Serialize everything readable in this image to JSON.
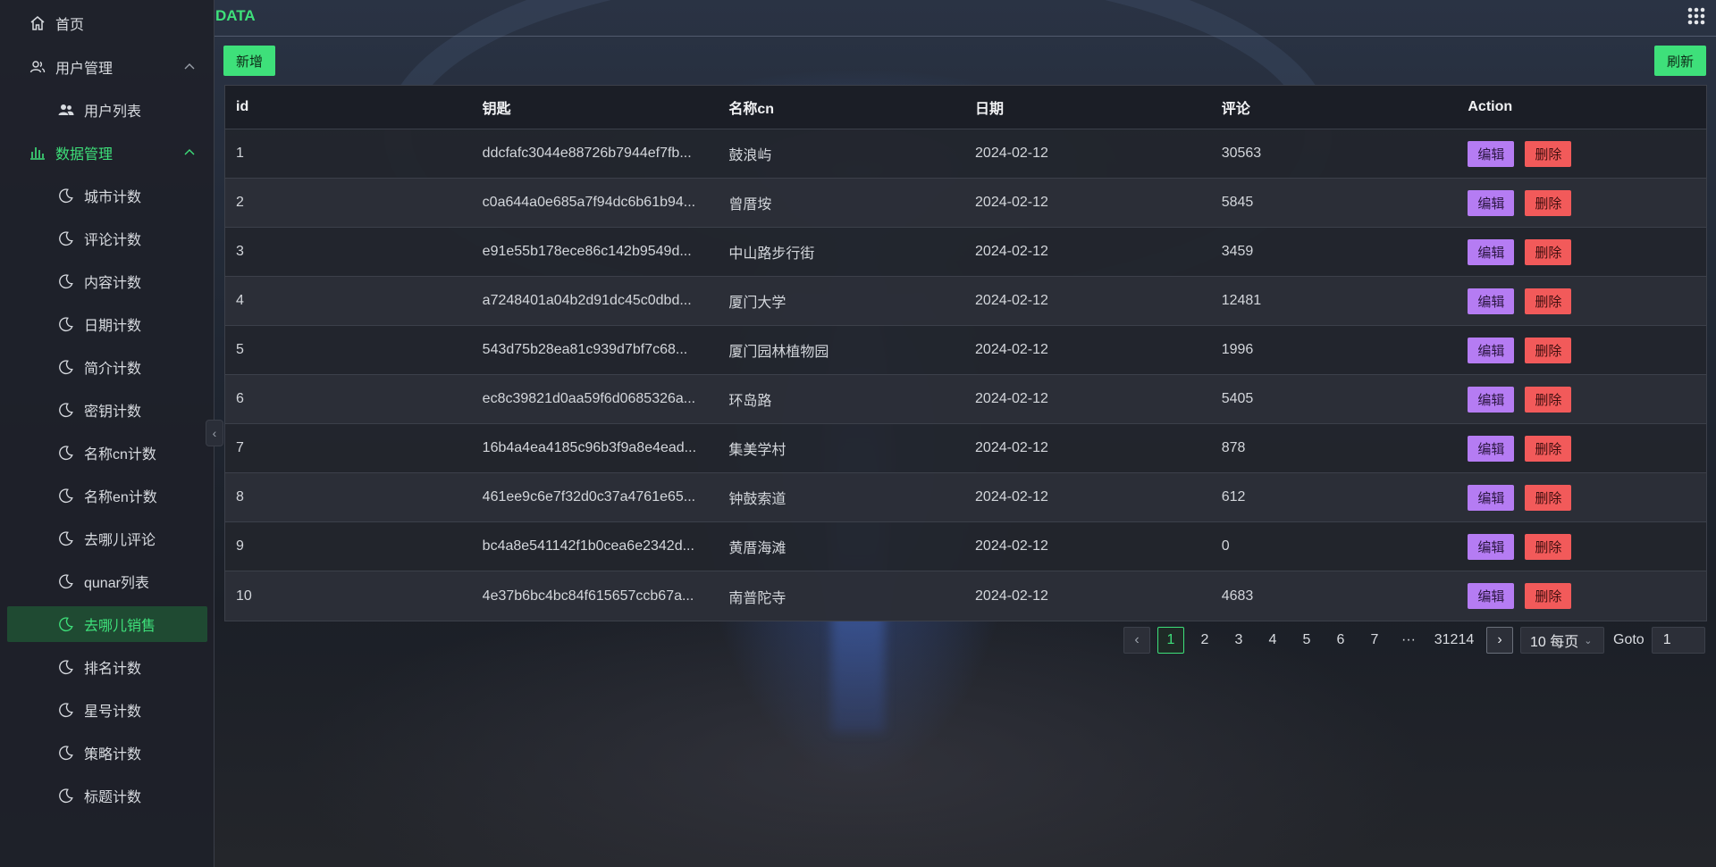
{
  "app": {
    "title": "DATA"
  },
  "sidebar": {
    "items": [
      {
        "label": "首页",
        "icon": "home-icon"
      },
      {
        "label": "用户管理",
        "icon": "users-icon"
      },
      {
        "label": "用户列表",
        "icon": "user-group-icon"
      },
      {
        "label": "数据管理",
        "icon": "bar-chart-icon"
      },
      {
        "label": "城市计数",
        "icon": "moon-icon"
      },
      {
        "label": "评论计数",
        "icon": "moon-icon"
      },
      {
        "label": "内容计数",
        "icon": "moon-icon"
      },
      {
        "label": "日期计数",
        "icon": "moon-icon"
      },
      {
        "label": "简介计数",
        "icon": "moon-icon"
      },
      {
        "label": "密钥计数",
        "icon": "moon-icon"
      },
      {
        "label": "名称cn计数",
        "icon": "moon-icon"
      },
      {
        "label": "名称en计数",
        "icon": "moon-icon"
      },
      {
        "label": "去哪儿评论",
        "icon": "moon-icon"
      },
      {
        "label": "qunar列表",
        "icon": "moon-icon"
      },
      {
        "label": "去哪儿销售",
        "icon": "moon-icon"
      },
      {
        "label": "排名计数",
        "icon": "moon-icon"
      },
      {
        "label": "星号计数",
        "icon": "moon-icon"
      },
      {
        "label": "策略计数",
        "icon": "moon-icon"
      },
      {
        "label": "标题计数",
        "icon": "moon-icon"
      }
    ],
    "active_item": "去哪儿销售"
  },
  "toolbar": {
    "add_label": "新增",
    "refresh_label": "刷新"
  },
  "table": {
    "columns": [
      "id",
      "钥匙",
      "名称cn",
      "日期",
      "评论",
      "Action"
    ],
    "edit_label": "编辑",
    "delete_label": "删除",
    "rows": [
      {
        "id": "1",
        "key": "ddcfafc3044e88726b7944ef7fb...",
        "name": "鼓浪屿",
        "date": "2024-02-12",
        "comments": "30563"
      },
      {
        "id": "2",
        "key": "c0a644a0e685a7f94dc6b61b94...",
        "name": "曾厝垵",
        "date": "2024-02-12",
        "comments": "5845"
      },
      {
        "id": "3",
        "key": "e91e55b178ece86c142b9549d...",
        "name": "中山路步行街",
        "date": "2024-02-12",
        "comments": "3459"
      },
      {
        "id": "4",
        "key": "a7248401a04b2d91dc45c0dbd...",
        "name": "厦门大学",
        "date": "2024-02-12",
        "comments": "12481"
      },
      {
        "id": "5",
        "key": "543d75b28ea81c939d7bf7c68...",
        "name": "厦门园林植物园",
        "date": "2024-02-12",
        "comments": "1996"
      },
      {
        "id": "6",
        "key": "ec8c39821d0aa59f6d0685326a...",
        "name": "环岛路",
        "date": "2024-02-12",
        "comments": "5405"
      },
      {
        "id": "7",
        "key": "16b4a4ea4185c96b3f9a8e4ead...",
        "name": "集美学村",
        "date": "2024-02-12",
        "comments": "878"
      },
      {
        "id": "8",
        "key": "461ee9c6e7f32d0c37a4761e65...",
        "name": "钟鼓索道",
        "date": "2024-02-12",
        "comments": "612"
      },
      {
        "id": "9",
        "key": "bc4a8e541142f1b0cea6e2342d...",
        "name": "黄厝海滩",
        "date": "2024-02-12",
        "comments": "0"
      },
      {
        "id": "10",
        "key": "4e37b6bc4bc84f615657ccb67a...",
        "name": "南普陀寺",
        "date": "2024-02-12",
        "comments": "4683"
      }
    ]
  },
  "pagination": {
    "pages": [
      "1",
      "2",
      "3",
      "4",
      "5",
      "6",
      "7"
    ],
    "ellipsis": "···",
    "last_page": "31214",
    "current_page": "1",
    "page_size_label": "10 每页",
    "goto_label": "Goto",
    "goto_value": "1"
  },
  "colors": {
    "accent": "#3ee07a",
    "edit": "#b57cf3",
    "delete": "#f25a5a"
  }
}
